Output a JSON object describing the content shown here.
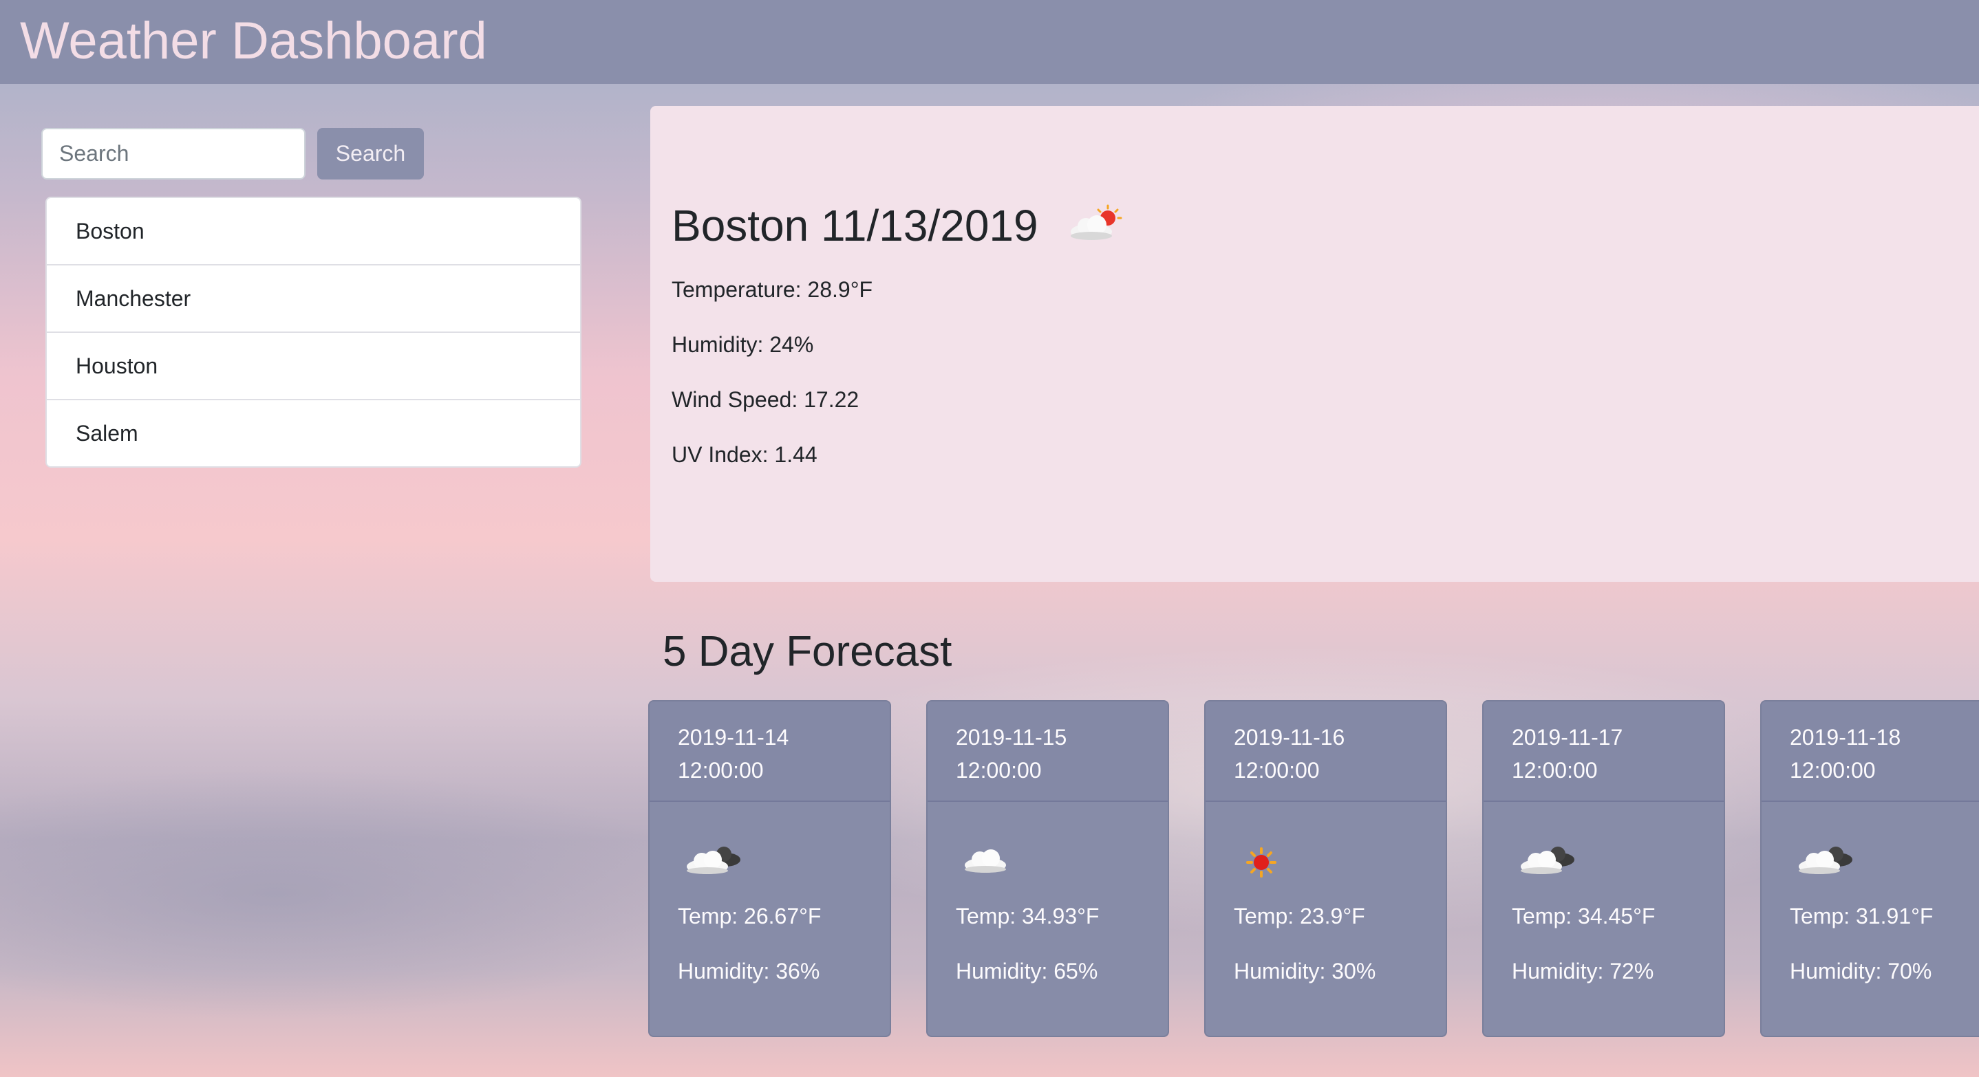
{
  "header": {
    "title": "Weather Dashboard"
  },
  "search": {
    "placeholder": "Search",
    "button_label": "Search"
  },
  "history": {
    "cities": [
      "Boston",
      "Manchester",
      "Houston",
      "Salem"
    ]
  },
  "current": {
    "title": "Boston 11/13/2019",
    "icon": "sun-behind-cloud-icon",
    "temperature": "Temperature: 28.9°F",
    "humidity": "Humidity: 24%",
    "wind_speed": "Wind Speed: 17.22",
    "uv_index": "UV Index: 1.44"
  },
  "forecast": {
    "heading": "5 Day Forecast",
    "days": [
      {
        "date": "2019-11-14",
        "time": "12:00:00",
        "icon": "broken-clouds-icon",
        "temp": "Temp: 26.67°F",
        "humidity": "Humidity: 36%"
      },
      {
        "date": "2019-11-15",
        "time": "12:00:00",
        "icon": "cloud-icon",
        "temp": "Temp: 34.93°F",
        "humidity": "Humidity: 65%"
      },
      {
        "date": "2019-11-16",
        "time": "12:00:00",
        "icon": "sun-icon",
        "temp": "Temp: 23.9°F",
        "humidity": "Humidity: 30%"
      },
      {
        "date": "2019-11-17",
        "time": "12:00:00",
        "icon": "broken-clouds-icon",
        "temp": "Temp: 34.45°F",
        "humidity": "Humidity: 72%"
      },
      {
        "date": "2019-11-18",
        "time": "12:00:00",
        "icon": "broken-clouds-icon",
        "temp": "Temp: 31.91°F",
        "humidity": "Humidity: 70%"
      }
    ]
  },
  "colors": {
    "navbar": "#8a8fab",
    "brand_text": "#f3dde6",
    "card_current": "#f3e2ea",
    "card_forecast": "#878ca8"
  }
}
